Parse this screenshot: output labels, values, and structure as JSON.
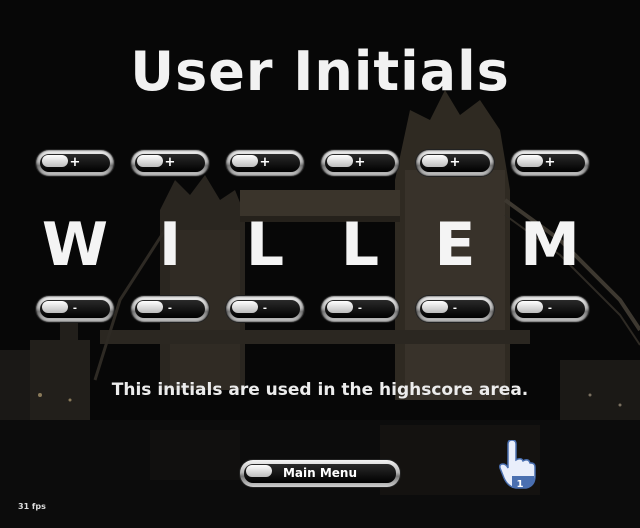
{
  "title": "User Initials",
  "plus_symbol": "+",
  "minus_symbol": "-",
  "initials": [
    "W",
    "I",
    "L",
    "L",
    "E",
    "M"
  ],
  "info_text": "This initials are used in the highscore area.",
  "menu_button_label": "Main Menu",
  "cursor_badge": "1",
  "fps_text": "31 fps",
  "colors": {
    "text": "#f2f2f2",
    "button_chrome": "#b9b9b9",
    "button_core": "#000000",
    "cursor_blue": "#4a6fb0"
  }
}
